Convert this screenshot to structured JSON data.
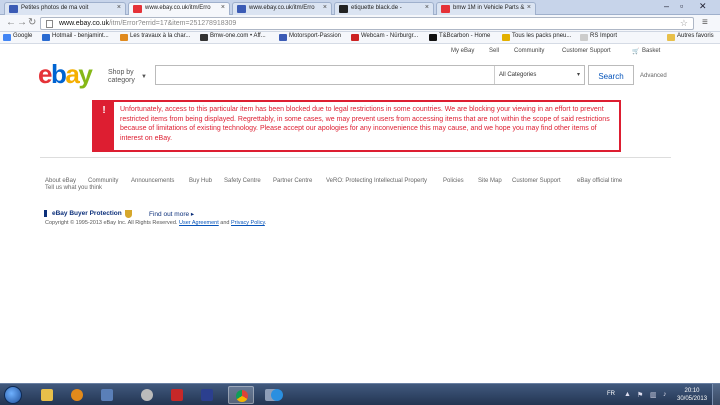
{
  "browser": {
    "tabs": [
      {
        "title": "Petites photos de ma voit",
        "color": "#3b5bb5"
      },
      {
        "title": "www.ebay.co.uk/itm/Erro",
        "color": "#e53238"
      },
      {
        "title": "www.ebay.co.uk/itm/Erro",
        "color": "#3b5bb5"
      },
      {
        "title": "etiquette black.de -",
        "color": "#222222"
      },
      {
        "title": "bmw 1M in Vehicle Parts &",
        "color": "#e53238"
      }
    ],
    "url_host": "www.ebay.co.uk",
    "url_path": "/itm/Error?errid=17&item=251278918309",
    "bookmarks": [
      {
        "label": "Google",
        "color": "#4285f4"
      },
      {
        "label": "Hotmail - benjamint...",
        "color": "#2a6bd1"
      },
      {
        "label": "Les travaux à la char...",
        "color": "#e08a1e"
      },
      {
        "label": "Bmw-one.com • Aff...",
        "color": "#333333"
      },
      {
        "label": "Motorsport-Passion",
        "color": "#3b5bb5"
      },
      {
        "label": "Webcam - Nürburgr...",
        "color": "#cc2222"
      },
      {
        "label": "T&Bcarbon - Home",
        "color": "#111111"
      },
      {
        "label": "Tous les packs pneu...",
        "color": "#e3b000"
      },
      {
        "label": "RS Import",
        "color": "#cccccc"
      },
      {
        "label": "Autres favoris",
        "color": "#e8c04a"
      }
    ]
  },
  "ebay": {
    "topnav": [
      "My eBay",
      "Sell",
      "Community",
      "Customer Support",
      "Basket"
    ],
    "shop_by_line1": "Shop by",
    "shop_by_line2": "category",
    "search_category": "All Categories",
    "search_button": "Search",
    "advanced": "Advanced",
    "alert_icon": "!",
    "alert_message": "Unfortunately, access to this particular item has been blocked due to legal restrictions in some countries. We are blocking your viewing in an effort to prevent restricted items from being displayed. Regrettably, in some cases, we may prevent users from accessing items that are not within the scope of said restrictions because of limitations of existing technology. Please accept our apologies for any inconvenience this may cause, and we hope you may find other items of interest on eBay.",
    "footer_links": [
      "About eBay",
      "Community",
      "Announcements",
      "Buy Hub",
      "Safety Centre",
      "Partner Centre",
      "VeRO: Protecting Intellectual Property",
      "Policies",
      "Site Map",
      "Customer Support",
      "eBay official time"
    ],
    "tell_us": "Tell us what you think",
    "buyer_protection": "eBay Buyer Protection",
    "find_out_more": "Find out more ▸",
    "copyright_text": "Copyright © 1995-2013 eBay Inc. All Rights Reserved.",
    "user_agreement": "User Agreement",
    "and_text": "and",
    "privacy_policy": "Privacy Policy"
  },
  "taskbar": {
    "language": "FR",
    "time": "20:10",
    "date": "30/05/2013"
  },
  "colors": {
    "alert_red": "#dd1e31",
    "ebay_blue": "#0654ba"
  }
}
